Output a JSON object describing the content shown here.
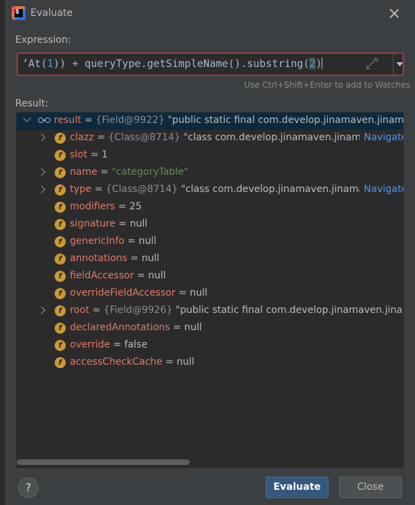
{
  "window": {
    "title": "Evaluate"
  },
  "expression": {
    "label": "Expression:",
    "code": {
      "p1": "’At(",
      "n1": "1",
      "p2": ")) + queryType.getSimpleName().substring(",
      "n2": "2",
      "p3": ")"
    },
    "hint": "Use Ctrl+Shift+Enter to add to Watches"
  },
  "result": {
    "label": "Result:",
    "root": {
      "name": "result",
      "eq": " = ",
      "ref": "{Field@9922}",
      "value": " \"public static final com.develop.jinamaven.jinamaven.c"
    },
    "fields": [
      {
        "name": "clazz",
        "eq": " = ",
        "ref": "{Class@8714}",
        "value": " \"class com.develop.jinamaven.jinamaven.",
        "nav": "Navigate"
      },
      {
        "name": "slot",
        "eq": " = ",
        "value": "1"
      },
      {
        "name": "name",
        "eq": " = ",
        "str": "\"categoryTable\""
      },
      {
        "name": "type",
        "eq": " = ",
        "ref": "{Class@8714}",
        "value": " \"class com.develop.jinamaven.jinamaven.",
        "nav": "Navigate"
      },
      {
        "name": "modifiers",
        "eq": " = ",
        "value": "25"
      },
      {
        "name": "signature",
        "eq": " = ",
        "value": "null"
      },
      {
        "name": "genericInfo",
        "eq": " = ",
        "value": "null"
      },
      {
        "name": "annotations",
        "eq": " = ",
        "value": "null"
      },
      {
        "name": "fieldAccessor",
        "eq": " = ",
        "value": "null"
      },
      {
        "name": "overrideFieldAccessor",
        "eq": " = ",
        "value": "null"
      },
      {
        "name": "root",
        "eq": " = ",
        "ref": "{Field@9926}",
        "value": " \"public static final com.develop.jinamaven.jinamaven"
      },
      {
        "name": "declaredAnnotations",
        "eq": " = ",
        "value": "null"
      },
      {
        "name": "override",
        "eq": " = ",
        "value": "false"
      },
      {
        "name": "accessCheckCache",
        "eq": " = ",
        "value": "null"
      }
    ]
  },
  "buttons": {
    "help": "?",
    "evaluate": "Evaluate",
    "close": "Close"
  },
  "field_icon_letter": "f",
  "colors": {
    "accent": "#365880",
    "selection": "#0d293e",
    "error_border": "#a33a3a",
    "field_icon": "#c99a38"
  },
  "icons": [
    "app-icon",
    "close-icon",
    "expand-icon",
    "dropdown-arrow-icon",
    "chevron-icon",
    "watch-glasses-icon",
    "field-icon",
    "help-icon"
  ]
}
